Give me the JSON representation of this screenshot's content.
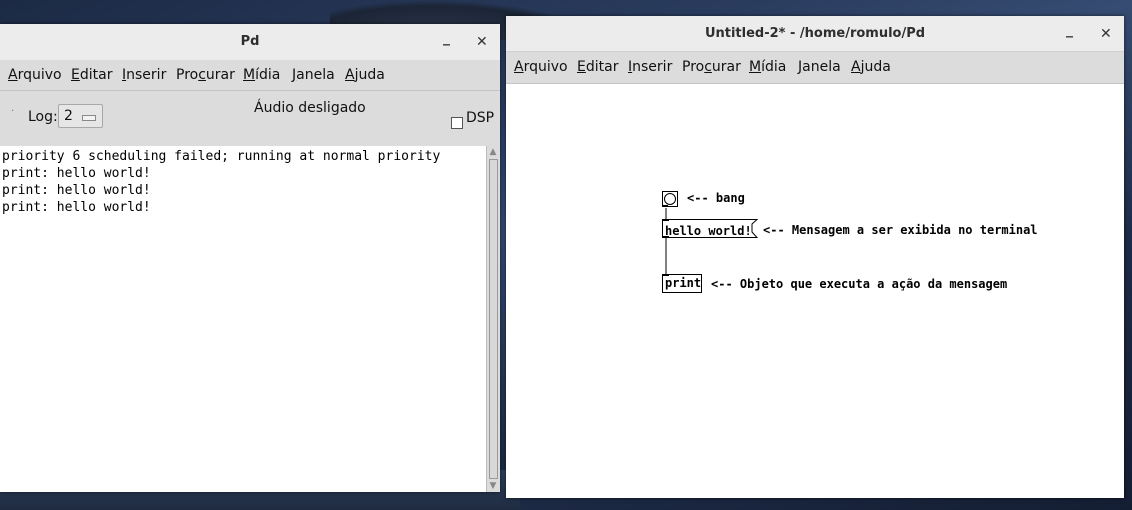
{
  "console_window": {
    "title": "Pd",
    "menu": [
      "Arquivo",
      "Editar",
      "Inserir",
      "Procurar",
      "Mídia",
      "Janela",
      "Ajuda"
    ],
    "log_label": "Log:",
    "log_value": "2",
    "audio_status": "Áudio desligado",
    "dsp_label": "DSP",
    "dsp_checked": false,
    "console_lines": [
      "priority 6 scheduling failed; running at normal priority",
      "print: hello world!",
      "print: hello world!",
      "print: hello world!"
    ]
  },
  "patch_window": {
    "title": "Untitled-2* - /home/romulo/Pd",
    "menu": [
      "Arquivo",
      "Editar",
      "Inserir",
      "Procurar",
      "Mídia",
      "Janela",
      "Ajuda"
    ],
    "objects": {
      "message_text": "hello world!",
      "print_text": "print"
    },
    "comments": {
      "bang": "<-- bang",
      "message": "<-- Mensagem a ser exibida no terminal",
      "print": "<-- Objeto que executa a ação da mensagem"
    }
  },
  "window_controls": {
    "minimize": "_",
    "close": "✕"
  }
}
